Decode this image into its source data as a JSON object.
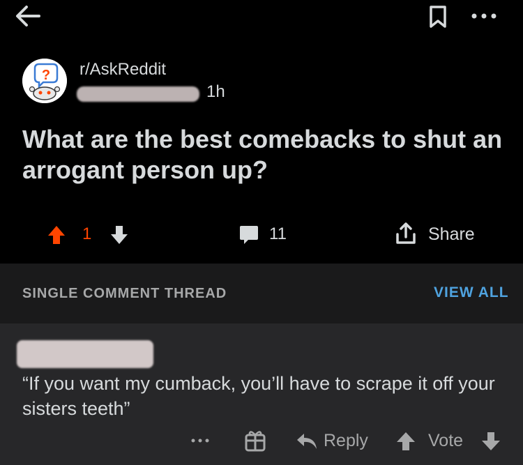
{
  "colors": {
    "background": "#000000",
    "thread_bar": "#1a1a1b",
    "comment_bg": "#272729",
    "upvote": "#ff4500",
    "link": "#4fa3e0"
  },
  "icons": [
    "back-arrow-icon",
    "bookmark-icon",
    "more-options-icon",
    "subreddit-avatar-icon",
    "upvote-icon",
    "downvote-icon",
    "comment-icon",
    "share-icon",
    "gift-icon",
    "reply-icon"
  ],
  "post": {
    "subreddit": "r/AskReddit",
    "time": "1h",
    "title": "What are the best comebacks to shut an arrogant person up?",
    "score": "1",
    "comment_count": "11",
    "share_label": "Share"
  },
  "thread": {
    "label": "SINGLE COMMENT THREAD",
    "view_all": "VIEW ALL"
  },
  "comment": {
    "body": "“If you want my cumback, you’ll have to scrape it off your sisters teeth”",
    "reply_label": "Reply",
    "vote_label": "Vote"
  }
}
